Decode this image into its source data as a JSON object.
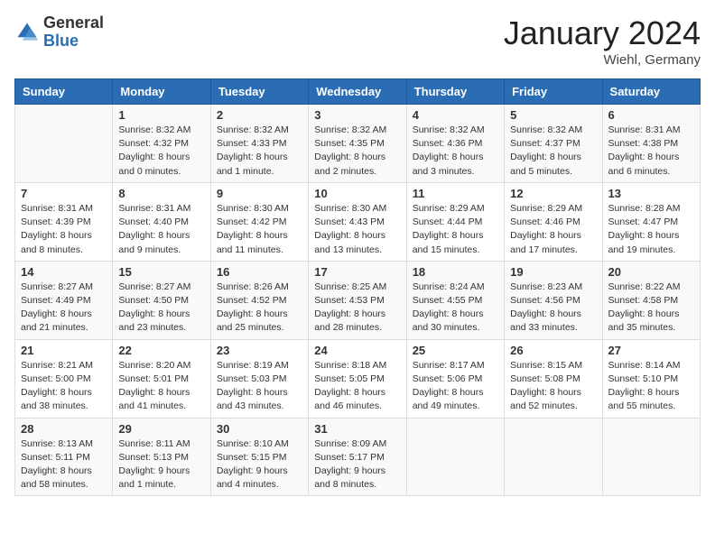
{
  "header": {
    "logo_general": "General",
    "logo_blue": "Blue",
    "month_title": "January 2024",
    "location": "Wiehl, Germany"
  },
  "weekdays": [
    "Sunday",
    "Monday",
    "Tuesday",
    "Wednesday",
    "Thursday",
    "Friday",
    "Saturday"
  ],
  "weeks": [
    [
      {
        "day": "",
        "sunrise": "",
        "sunset": "",
        "daylight": ""
      },
      {
        "day": "1",
        "sunrise": "Sunrise: 8:32 AM",
        "sunset": "Sunset: 4:32 PM",
        "daylight": "Daylight: 8 hours and 0 minutes."
      },
      {
        "day": "2",
        "sunrise": "Sunrise: 8:32 AM",
        "sunset": "Sunset: 4:33 PM",
        "daylight": "Daylight: 8 hours and 1 minute."
      },
      {
        "day": "3",
        "sunrise": "Sunrise: 8:32 AM",
        "sunset": "Sunset: 4:35 PM",
        "daylight": "Daylight: 8 hours and 2 minutes."
      },
      {
        "day": "4",
        "sunrise": "Sunrise: 8:32 AM",
        "sunset": "Sunset: 4:36 PM",
        "daylight": "Daylight: 8 hours and 3 minutes."
      },
      {
        "day": "5",
        "sunrise": "Sunrise: 8:32 AM",
        "sunset": "Sunset: 4:37 PM",
        "daylight": "Daylight: 8 hours and 5 minutes."
      },
      {
        "day": "6",
        "sunrise": "Sunrise: 8:31 AM",
        "sunset": "Sunset: 4:38 PM",
        "daylight": "Daylight: 8 hours and 6 minutes."
      }
    ],
    [
      {
        "day": "7",
        "sunrise": "Sunrise: 8:31 AM",
        "sunset": "Sunset: 4:39 PM",
        "daylight": "Daylight: 8 hours and 8 minutes."
      },
      {
        "day": "8",
        "sunrise": "Sunrise: 8:31 AM",
        "sunset": "Sunset: 4:40 PM",
        "daylight": "Daylight: 8 hours and 9 minutes."
      },
      {
        "day": "9",
        "sunrise": "Sunrise: 8:30 AM",
        "sunset": "Sunset: 4:42 PM",
        "daylight": "Daylight: 8 hours and 11 minutes."
      },
      {
        "day": "10",
        "sunrise": "Sunrise: 8:30 AM",
        "sunset": "Sunset: 4:43 PM",
        "daylight": "Daylight: 8 hours and 13 minutes."
      },
      {
        "day": "11",
        "sunrise": "Sunrise: 8:29 AM",
        "sunset": "Sunset: 4:44 PM",
        "daylight": "Daylight: 8 hours and 15 minutes."
      },
      {
        "day": "12",
        "sunrise": "Sunrise: 8:29 AM",
        "sunset": "Sunset: 4:46 PM",
        "daylight": "Daylight: 8 hours and 17 minutes."
      },
      {
        "day": "13",
        "sunrise": "Sunrise: 8:28 AM",
        "sunset": "Sunset: 4:47 PM",
        "daylight": "Daylight: 8 hours and 19 minutes."
      }
    ],
    [
      {
        "day": "14",
        "sunrise": "Sunrise: 8:27 AM",
        "sunset": "Sunset: 4:49 PM",
        "daylight": "Daylight: 8 hours and 21 minutes."
      },
      {
        "day": "15",
        "sunrise": "Sunrise: 8:27 AM",
        "sunset": "Sunset: 4:50 PM",
        "daylight": "Daylight: 8 hours and 23 minutes."
      },
      {
        "day": "16",
        "sunrise": "Sunrise: 8:26 AM",
        "sunset": "Sunset: 4:52 PM",
        "daylight": "Daylight: 8 hours and 25 minutes."
      },
      {
        "day": "17",
        "sunrise": "Sunrise: 8:25 AM",
        "sunset": "Sunset: 4:53 PM",
        "daylight": "Daylight: 8 hours and 28 minutes."
      },
      {
        "day": "18",
        "sunrise": "Sunrise: 8:24 AM",
        "sunset": "Sunset: 4:55 PM",
        "daylight": "Daylight: 8 hours and 30 minutes."
      },
      {
        "day": "19",
        "sunrise": "Sunrise: 8:23 AM",
        "sunset": "Sunset: 4:56 PM",
        "daylight": "Daylight: 8 hours and 33 minutes."
      },
      {
        "day": "20",
        "sunrise": "Sunrise: 8:22 AM",
        "sunset": "Sunset: 4:58 PM",
        "daylight": "Daylight: 8 hours and 35 minutes."
      }
    ],
    [
      {
        "day": "21",
        "sunrise": "Sunrise: 8:21 AM",
        "sunset": "Sunset: 5:00 PM",
        "daylight": "Daylight: 8 hours and 38 minutes."
      },
      {
        "day": "22",
        "sunrise": "Sunrise: 8:20 AM",
        "sunset": "Sunset: 5:01 PM",
        "daylight": "Daylight: 8 hours and 41 minutes."
      },
      {
        "day": "23",
        "sunrise": "Sunrise: 8:19 AM",
        "sunset": "Sunset: 5:03 PM",
        "daylight": "Daylight: 8 hours and 43 minutes."
      },
      {
        "day": "24",
        "sunrise": "Sunrise: 8:18 AM",
        "sunset": "Sunset: 5:05 PM",
        "daylight": "Daylight: 8 hours and 46 minutes."
      },
      {
        "day": "25",
        "sunrise": "Sunrise: 8:17 AM",
        "sunset": "Sunset: 5:06 PM",
        "daylight": "Daylight: 8 hours and 49 minutes."
      },
      {
        "day": "26",
        "sunrise": "Sunrise: 8:15 AM",
        "sunset": "Sunset: 5:08 PM",
        "daylight": "Daylight: 8 hours and 52 minutes."
      },
      {
        "day": "27",
        "sunrise": "Sunrise: 8:14 AM",
        "sunset": "Sunset: 5:10 PM",
        "daylight": "Daylight: 8 hours and 55 minutes."
      }
    ],
    [
      {
        "day": "28",
        "sunrise": "Sunrise: 8:13 AM",
        "sunset": "Sunset: 5:11 PM",
        "daylight": "Daylight: 8 hours and 58 minutes."
      },
      {
        "day": "29",
        "sunrise": "Sunrise: 8:11 AM",
        "sunset": "Sunset: 5:13 PM",
        "daylight": "Daylight: 9 hours and 1 minute."
      },
      {
        "day": "30",
        "sunrise": "Sunrise: 8:10 AM",
        "sunset": "Sunset: 5:15 PM",
        "daylight": "Daylight: 9 hours and 4 minutes."
      },
      {
        "day": "31",
        "sunrise": "Sunrise: 8:09 AM",
        "sunset": "Sunset: 5:17 PM",
        "daylight": "Daylight: 9 hours and 8 minutes."
      },
      {
        "day": "",
        "sunrise": "",
        "sunset": "",
        "daylight": ""
      },
      {
        "day": "",
        "sunrise": "",
        "sunset": "",
        "daylight": ""
      },
      {
        "day": "",
        "sunrise": "",
        "sunset": "",
        "daylight": ""
      }
    ]
  ]
}
